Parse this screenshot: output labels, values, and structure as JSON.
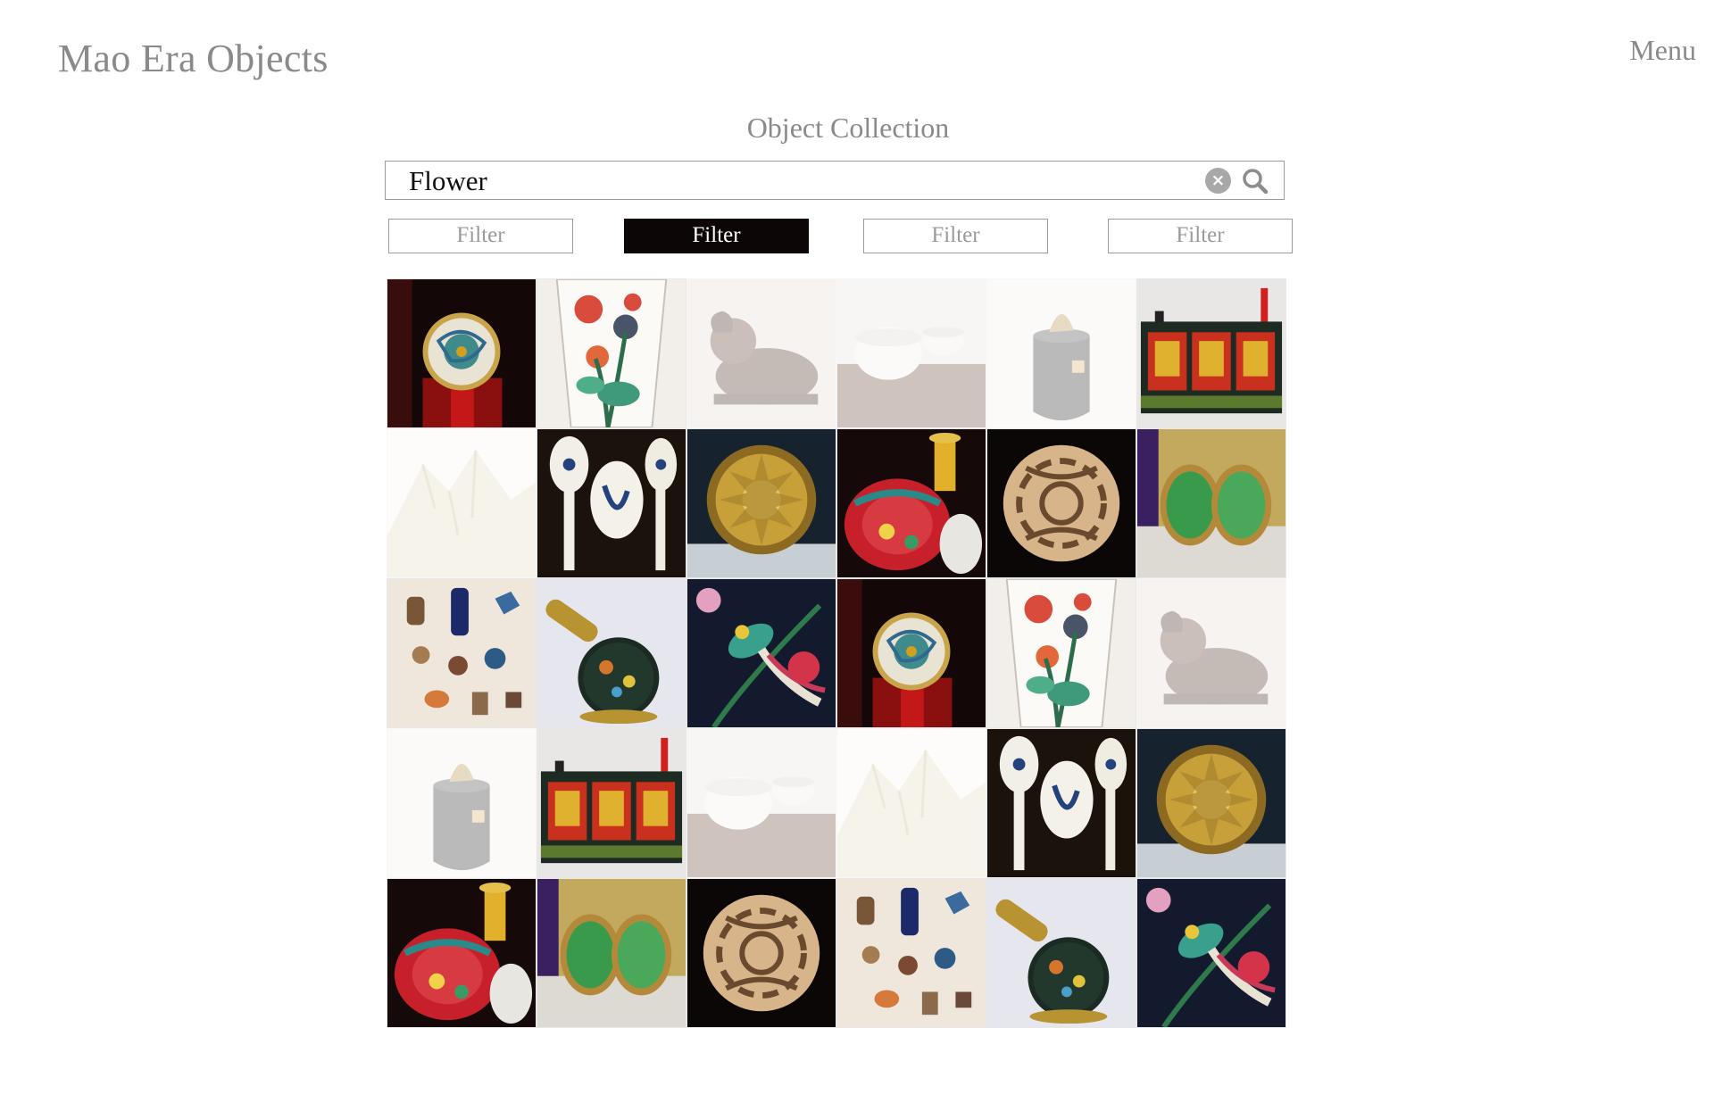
{
  "header": {
    "site_title": "Mao Era Objects",
    "menu_label": "Menu"
  },
  "main": {
    "title": "Object Collection",
    "search": {
      "value": "Flower",
      "clear_icon": "x-circle-icon",
      "search_icon": "magnifier-icon"
    },
    "filters": [
      {
        "label": "Filter",
        "active": false
      },
      {
        "label": "Filter",
        "active": true
      },
      {
        "label": "Filter",
        "active": false
      },
      {
        "label": "Filter",
        "active": false
      }
    ]
  },
  "colors": {
    "active_filter_bg": "#0c0606",
    "muted_text": "#8a8a8a",
    "border": "#9b9b9b"
  },
  "gallery": {
    "columns": 6,
    "items": [
      {
        "type": "dragon-plate",
        "faded": false
      },
      {
        "type": "flower-vase",
        "faded": false
      },
      {
        "type": "ram-figure",
        "faded": true
      },
      {
        "type": "bowls",
        "faded": true
      },
      {
        "type": "jar-figurine",
        "faded": true
      },
      {
        "type": "lacquer-cabinet",
        "faded": false
      },
      {
        "type": "mountain",
        "faded": true
      },
      {
        "type": "spoons",
        "faded": false
      },
      {
        "type": "gold-disk",
        "faded": false
      },
      {
        "type": "enamel-vase",
        "faded": false
      },
      {
        "type": "jade-carving",
        "faded": false
      },
      {
        "type": "jade-earrings",
        "faded": false
      },
      {
        "type": "miniatures",
        "faded": false
      },
      {
        "type": "cloisonne-box",
        "faded": false
      },
      {
        "type": "bird-textile",
        "faded": false
      },
      {
        "type": "dragon-plate",
        "faded": false
      },
      {
        "type": "flower-vase",
        "faded": false
      },
      {
        "type": "ram-figure",
        "faded": true
      },
      {
        "type": "jar-figurine",
        "faded": true
      },
      {
        "type": "lacquer-cabinet",
        "faded": false
      },
      {
        "type": "bowls",
        "faded": true
      },
      {
        "type": "mountain",
        "faded": true
      },
      {
        "type": "spoons",
        "faded": false
      },
      {
        "type": "gold-disk",
        "faded": false
      },
      {
        "type": "enamel-vase",
        "faded": false
      },
      {
        "type": "jade-earrings",
        "faded": false
      },
      {
        "type": "jade-carving",
        "faded": false
      },
      {
        "type": "miniatures",
        "faded": false
      },
      {
        "type": "cloisonne-box",
        "faded": false
      },
      {
        "type": "bird-textile",
        "faded": false
      }
    ]
  }
}
